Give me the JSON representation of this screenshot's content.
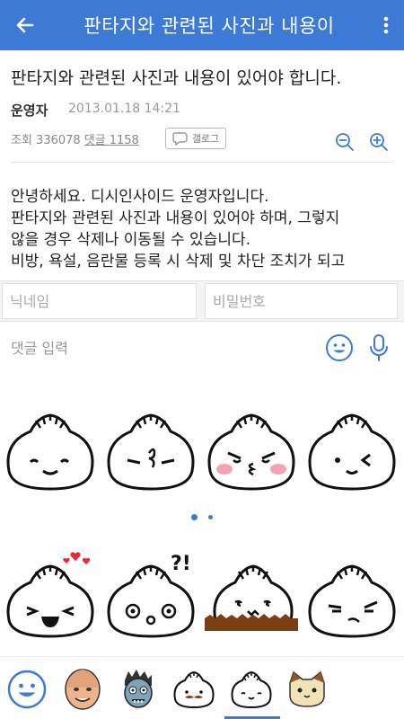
{
  "header": {
    "title": "판타지와 관련된 사진과 내용이"
  },
  "post": {
    "title": "판타지와 관련된 사진과 내용이 있어야 합니다.",
    "author": "운영자",
    "date": "2013.01.18 14:21",
    "views_label": "조회 336078",
    "comments_label": "댓글 1158",
    "gallog_label": "갤로그",
    "body_lines": [
      "안녕하세요. 디시인사이드 운영자입니다.",
      "판타지와 관련된 사진과 내용이 있어야 하며, 그렇지",
      "않을 경우 삭제나 이동될 수 있습니다.",
      "비방, 욕설, 음란물 등록 시 삭제 및 차단 조치가 되고"
    ]
  },
  "form": {
    "nickname_placeholder": "닉네임",
    "password_placeholder": "비밀번호",
    "comment_placeholder": "댓글 입력"
  },
  "stickers": {
    "page_count": 2,
    "active_page": 1,
    "items": [
      "smile",
      "frown-curl",
      "angry-blush",
      "wink",
      "laugh-hearts",
      "surprised",
      "ground-dumpling",
      "annoyed"
    ]
  },
  "tabs": [
    "emoji-tab",
    "face-sticker-tab",
    "zombie-sticker-tab",
    "mustache-dumpling-tab",
    "dumpling-tab",
    "cat-tab"
  ],
  "colors": {
    "accent": "#3d7ad6"
  }
}
